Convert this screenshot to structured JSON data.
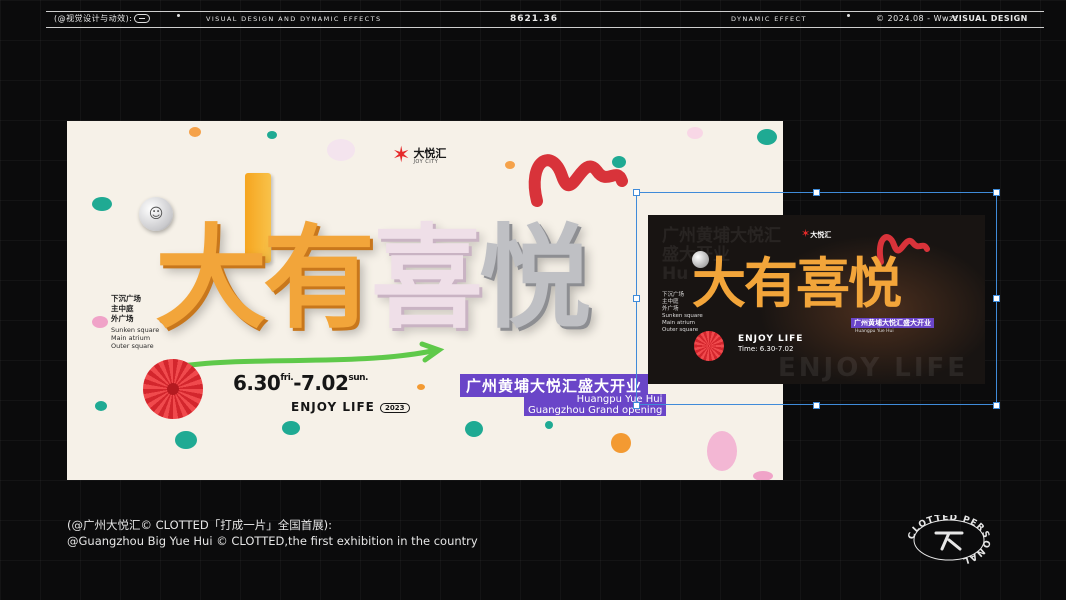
{
  "header": {
    "left_label": "(@视觉设计与动效):",
    "section_label": "VISUAL DESIGN AND DYNAMIC EFFECTS",
    "code": "8621.36",
    "dynamic_label": "DYNAMIC EFFECT",
    "date_credit": "© 2024.08 - Wwzz",
    "brand": "VISUAL DESIGN"
  },
  "poster": {
    "logo_text": "大悦汇",
    "logo_sub": "JOY CITY",
    "title_parts": [
      "大有",
      "喜",
      "悦"
    ],
    "locations_cn": [
      "下沉广场",
      "主中庭",
      "外广场"
    ],
    "locations_en": [
      "Sunken square",
      "Main atrium",
      "Outer square"
    ],
    "date_start": "6.30",
    "date_start_day": "fri.",
    "date_end": "-7.02",
    "date_end_day": "sun.",
    "enjoy": "ENJOY LIFE",
    "year": "2023",
    "banner_cn": "广州黄埔大悦汇盛大开业",
    "banner_en_1": "Huangpu Yue Hui",
    "banner_en_2": "Guangzhou Grand opening"
  },
  "preview": {
    "ghost_text_1": "广州黄埔大悦汇",
    "ghost_text_2": "盛大开业",
    "ghost_text_3": "Hu",
    "logo_text": "大悦汇",
    "title": "大有喜悦",
    "locations": [
      "下沉广场",
      "主中庭",
      "外广场",
      "Sunken square",
      "Main atrium",
      "Outer square"
    ],
    "enjoy": "ENJOY LIFE",
    "time": "Time: 6.30-7.02",
    "banner_cn": "广州黄埔大悦汇盛大开业",
    "banner_en": "Huangpu Yue Hui",
    "bottom_ghost": "ENJOY LIFE"
  },
  "caption": {
    "line_cn": "(@广州大悦汇© CLOTTED「打成一片」全国首展):",
    "line_en": "@Guangzhou Big Yue Hui © CLOTTED,the first exhibition in the country"
  },
  "badge": {
    "text": "CLOTTED PERSONAL"
  },
  "colors": {
    "background": "#0b0b0c",
    "poster_bg": "#f6f1e8",
    "accent_purple": "#6a45c8",
    "selection_blue": "#3f8bd9",
    "orange": "#f2a53a",
    "red": "#e62a2a"
  }
}
